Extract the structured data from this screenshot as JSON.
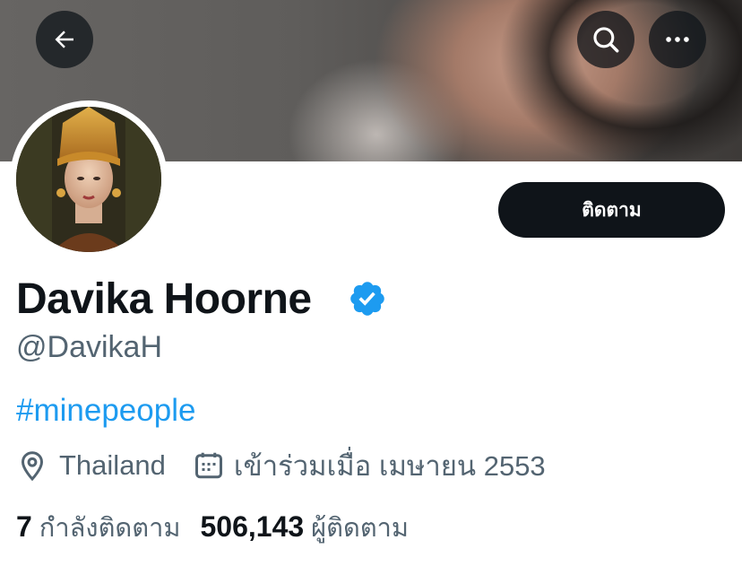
{
  "banner": {
    "alt": "profile header photo"
  },
  "nav": {
    "back_icon": "arrow-left-icon",
    "search_icon": "search-icon",
    "more_icon": "more-horizontal-icon"
  },
  "profile": {
    "display_name": "Davika Hoorne",
    "verified": true,
    "verified_color": "#1d9bf0",
    "handle": "@DavikaH",
    "bio": "#minepeople",
    "location": "Thailand",
    "joined": "เข้าร่วมเมื่อ เมษายน 2553",
    "follow_label": "ติดตาม"
  },
  "stats": {
    "following_count": "7",
    "following_label": "กำลังติดตาม",
    "followers_count": "506,143",
    "followers_label": "ผู้ติดตาม"
  },
  "colors": {
    "text": "#0f1419",
    "secondary": "#536471",
    "accent": "#1d9bf0",
    "button_bg": "#0f1419"
  }
}
